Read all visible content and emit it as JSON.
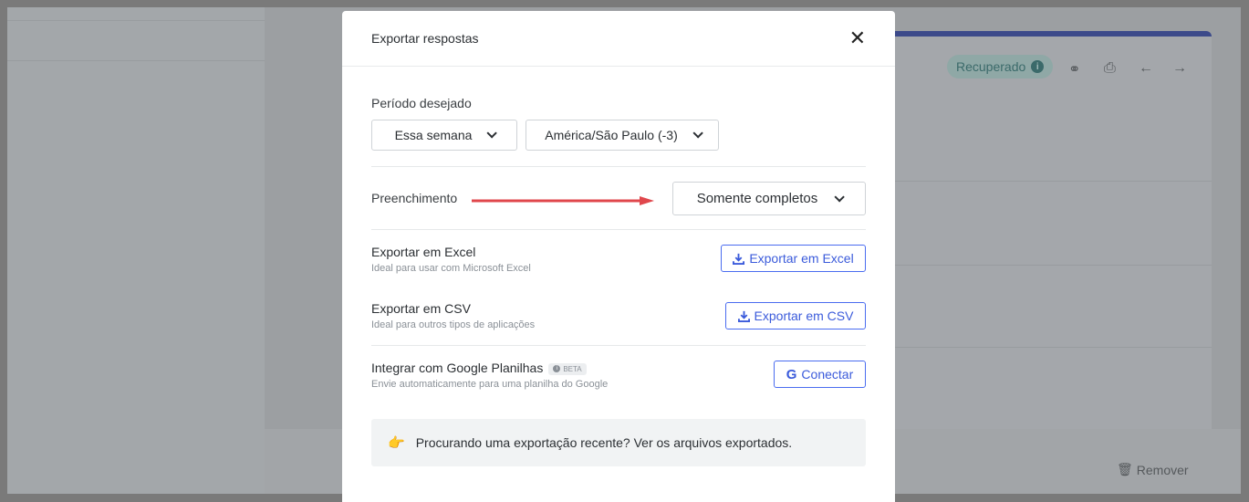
{
  "background": {
    "status_badge": "Recuperado",
    "status_badge_icon": "info-icon",
    "icons": [
      "link-icon",
      "print-icon",
      "arrow-left-icon",
      "arrow-right-icon"
    ],
    "remove_label": "Remover",
    "remove_icon": "trash-icon"
  },
  "modal": {
    "title": "Exportar respostas",
    "close_icon": "close-icon",
    "period": {
      "label": "Período desejado",
      "range_value": "Essa semana",
      "timezone_value": "América/São Paulo (-3)"
    },
    "filling": {
      "label": "Preenchimento",
      "value": "Somente completos",
      "annotation_arrow_color": "#e0474c"
    },
    "excel": {
      "title": "Exportar em Excel",
      "subtitle": "Ideal para usar com Microsoft Excel",
      "button": "Exportar em Excel"
    },
    "csv": {
      "title": "Exportar em CSV",
      "subtitle": "Ideal para outros tipos de aplicações",
      "button": "Exportar em CSV"
    },
    "sheets": {
      "title": "Integrar com Google Planilhas",
      "badge": "BETA",
      "subtitle": "Envie automaticamente para uma planilha do Google",
      "button": "Conectar",
      "button_icon": "G"
    },
    "notice": {
      "icon": "pointing-hand-icon",
      "text": "Procurando uma exportação recente? Ver os arquivos exportados."
    }
  },
  "colors": {
    "accent": "#3b5bdb",
    "overlay": "#9c9fa2"
  }
}
